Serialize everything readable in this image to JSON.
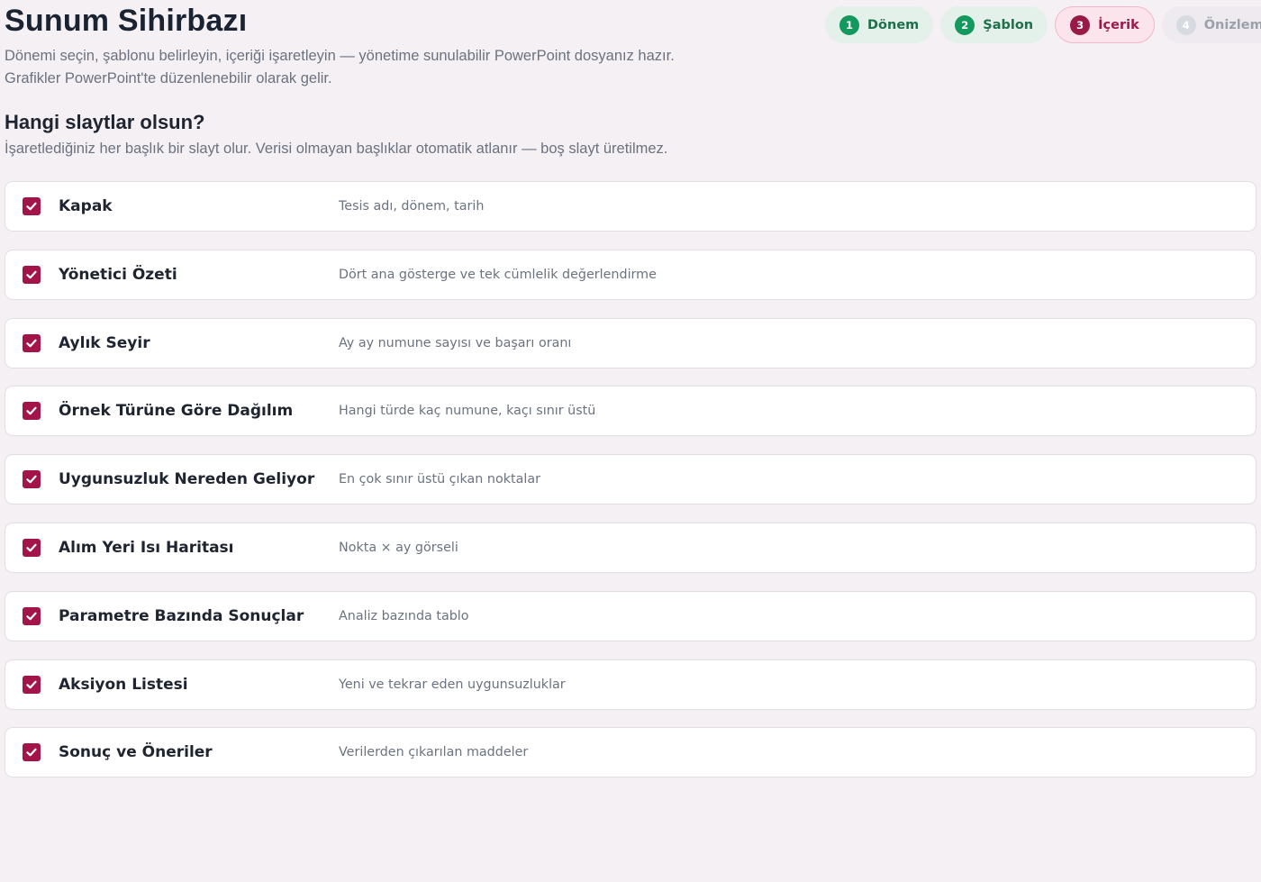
{
  "header": {
    "title": "Sunum Sihirbazı",
    "subtitle_line1": "Dönemi seçin, şablonu belirleyin, içeriği işaretleyin — yönetime sunulabilir PowerPoint dosyanız hazır.",
    "subtitle_line2": "Grafikler PowerPoint'te düzenlenebilir olarak gelir."
  },
  "steps": [
    {
      "num": "1",
      "label": "Dönem",
      "state": "done"
    },
    {
      "num": "2",
      "label": "Şablon",
      "state": "done"
    },
    {
      "num": "3",
      "label": "İçerik",
      "state": "active"
    },
    {
      "num": "4",
      "label": "Önizleme",
      "state": "todo"
    }
  ],
  "section": {
    "title": "Hangi slaytlar olsun?",
    "subtitle": "İşaretlediğiniz her başlık bir slayt olur. Verisi olmayan başlıklar otomatik atlanır — boş slayt üretilmez."
  },
  "slides": [
    {
      "title": "Kapak",
      "desc": "Tesis adı, dönem, tarih",
      "checked": true
    },
    {
      "title": "Yönetici Özeti",
      "desc": "Dört ana gösterge ve tek cümlelik değerlendirme",
      "checked": true
    },
    {
      "title": "Aylık Seyir",
      "desc": "Ay ay numune sayısı ve başarı oranı",
      "checked": true
    },
    {
      "title": "Örnek Türüne Göre Dağılım",
      "desc": "Hangi türde kaç numune, kaçı sınır üstü",
      "checked": true
    },
    {
      "title": "Uygunsuzluk Nereden Geliyor",
      "desc": "En çok sınır üstü çıkan noktalar",
      "checked": true
    },
    {
      "title": "Alım Yeri Isı Haritası",
      "desc": "Nokta × ay görseli",
      "checked": true
    },
    {
      "title": "Parametre Bazında Sonuçlar",
      "desc": "Analiz bazında tablo",
      "checked": true
    },
    {
      "title": "Aksiyon Listesi",
      "desc": "Yeni ve tekrar eden uygunsuzluklar",
      "checked": true
    },
    {
      "title": "Sonuç ve Öneriler",
      "desc": "Verilerden çıkarılan maddeler",
      "checked": true
    }
  ],
  "colors": {
    "accent": "#a3154a",
    "done": "#13995e",
    "background": "#f5f0f3"
  }
}
